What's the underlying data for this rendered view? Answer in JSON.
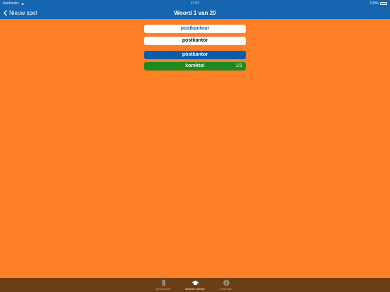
{
  "statusbar": {
    "carrier": "Aanbieder",
    "time": "17:07",
    "battery_text": "100%",
    "battery_level": 1.0
  },
  "navbar": {
    "back_label": "Nieuw spel",
    "title": "Woord 1 van 20"
  },
  "quiz": {
    "word": "postkantoor",
    "answer": "postkantór",
    "choice": "pòstkantor",
    "result_label": "korekto!",
    "result_count": "1/1"
  },
  "tabs": [
    {
      "label": "Woordenboek",
      "icon": "book-icon",
      "active": false
    },
    {
      "label": "Woorden oefenen",
      "icon": "graduation-cap-icon",
      "active": true
    },
    {
      "label": "Informatie",
      "icon": "info-icon",
      "active": false
    }
  ],
  "colors": {
    "background": "#ff7f27",
    "bar_blue": "#1565b0",
    "choice_blue": "#0b5dab",
    "correct_green": "#1e8a1e",
    "tabbar_brown": "#6a3f16"
  }
}
